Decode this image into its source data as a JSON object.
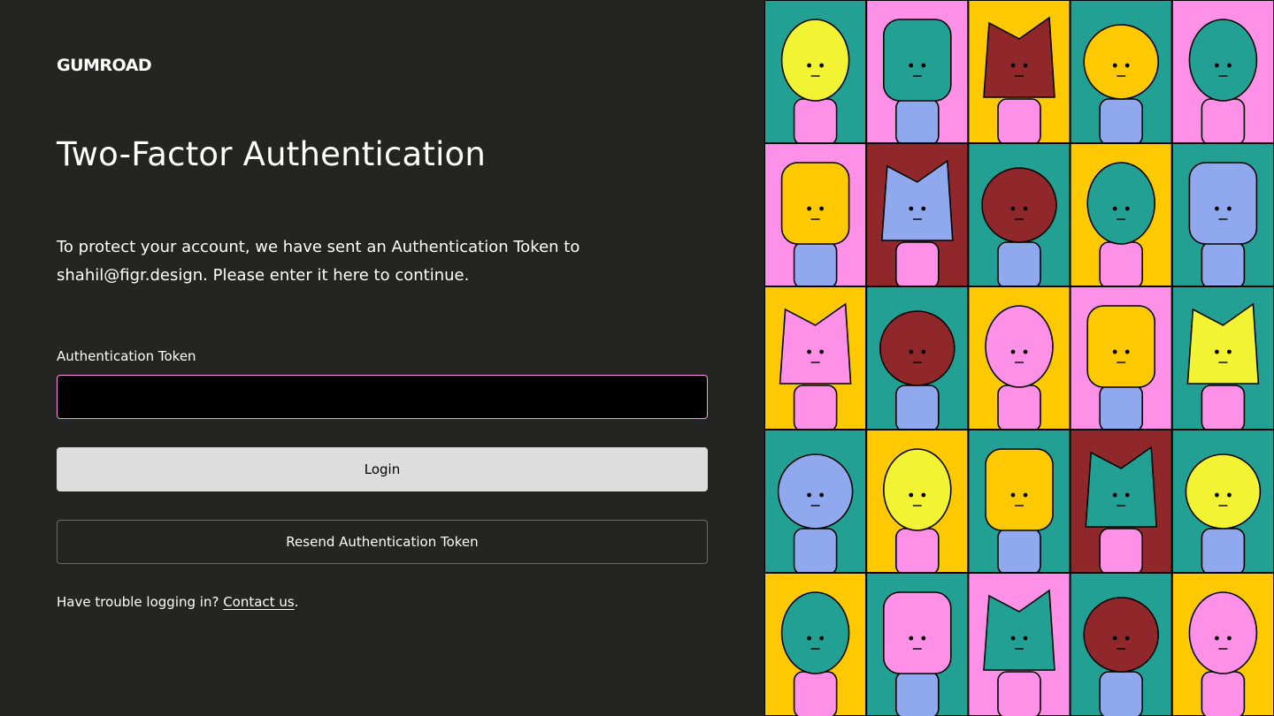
{
  "brand": {
    "logo_text": "GUMROAD"
  },
  "page": {
    "title": "Two-Factor Authentication"
  },
  "description": "To protect your account, we have sent an Authentication Token to shahil@figr.design. Please enter it here to continue.",
  "form": {
    "token_label": "Authentication Token",
    "token_value": "",
    "token_placeholder": "",
    "login_label": "Login",
    "resend_label": "Resend Authentication Token"
  },
  "help": {
    "prefix": "Have trouble logging in?",
    "link_label": "Contact us",
    "suffix": "."
  },
  "colors": {
    "background": "#242423",
    "accent_pink": "#ff90e8",
    "teal": "#23a094",
    "yellow": "#ffc900",
    "lemon": "#f1f333",
    "maroon": "#90282b",
    "lavender": "#90a8ed"
  },
  "illustration": {
    "description_icon": "character-grid-illustration",
    "rows": [
      [
        "teal",
        "pink",
        "yellow",
        "teal",
        "pink"
      ],
      [
        "pink",
        "maroon",
        "teal",
        "yellow",
        "teal"
      ],
      [
        "yellow",
        "teal",
        "yellow",
        "pink",
        "teal"
      ],
      [
        "teal",
        "yellow",
        "teal",
        "maroon",
        "teal"
      ],
      [
        "yellow",
        "teal",
        "pink",
        "teal",
        "yellow"
      ]
    ]
  }
}
